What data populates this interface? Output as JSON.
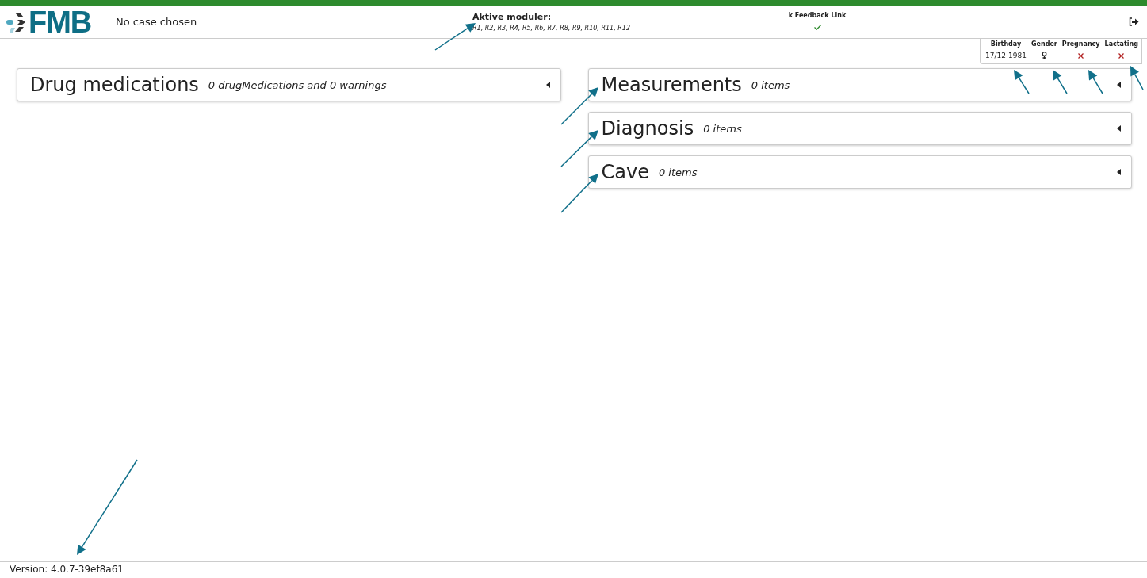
{
  "header": {
    "logo_text": "FMB",
    "case_label": "No case chosen",
    "modules": {
      "title": "Aktive moduler:",
      "list": "R1, R2, R3, R4, R5, R6, R7, R8, R9, R10, R11, R12"
    },
    "feedback": {
      "label": "k Feedback Link",
      "ok": true
    }
  },
  "patient": {
    "birthday": {
      "label": "Birthday",
      "value": "17/12-1981"
    },
    "gender": {
      "label": "Gender",
      "kind": "female"
    },
    "pregnancy": {
      "label": "Pregnancy",
      "on": false
    },
    "lactating": {
      "label": "Lactating",
      "on": false
    }
  },
  "left_panels": [
    {
      "title": "Drug medications",
      "summary": "0 drugMedications and 0 warnings",
      "expanded": false
    }
  ],
  "right_panels": [
    {
      "title": "Measurements",
      "summary": "0 items",
      "expanded": false
    },
    {
      "title": "Diagnosis",
      "summary": "0 items",
      "expanded": false
    },
    {
      "title": "Cave",
      "summary": "0 items",
      "expanded": false
    }
  ],
  "footer": {
    "version": "Version: 4.0.7-39ef8a61"
  }
}
